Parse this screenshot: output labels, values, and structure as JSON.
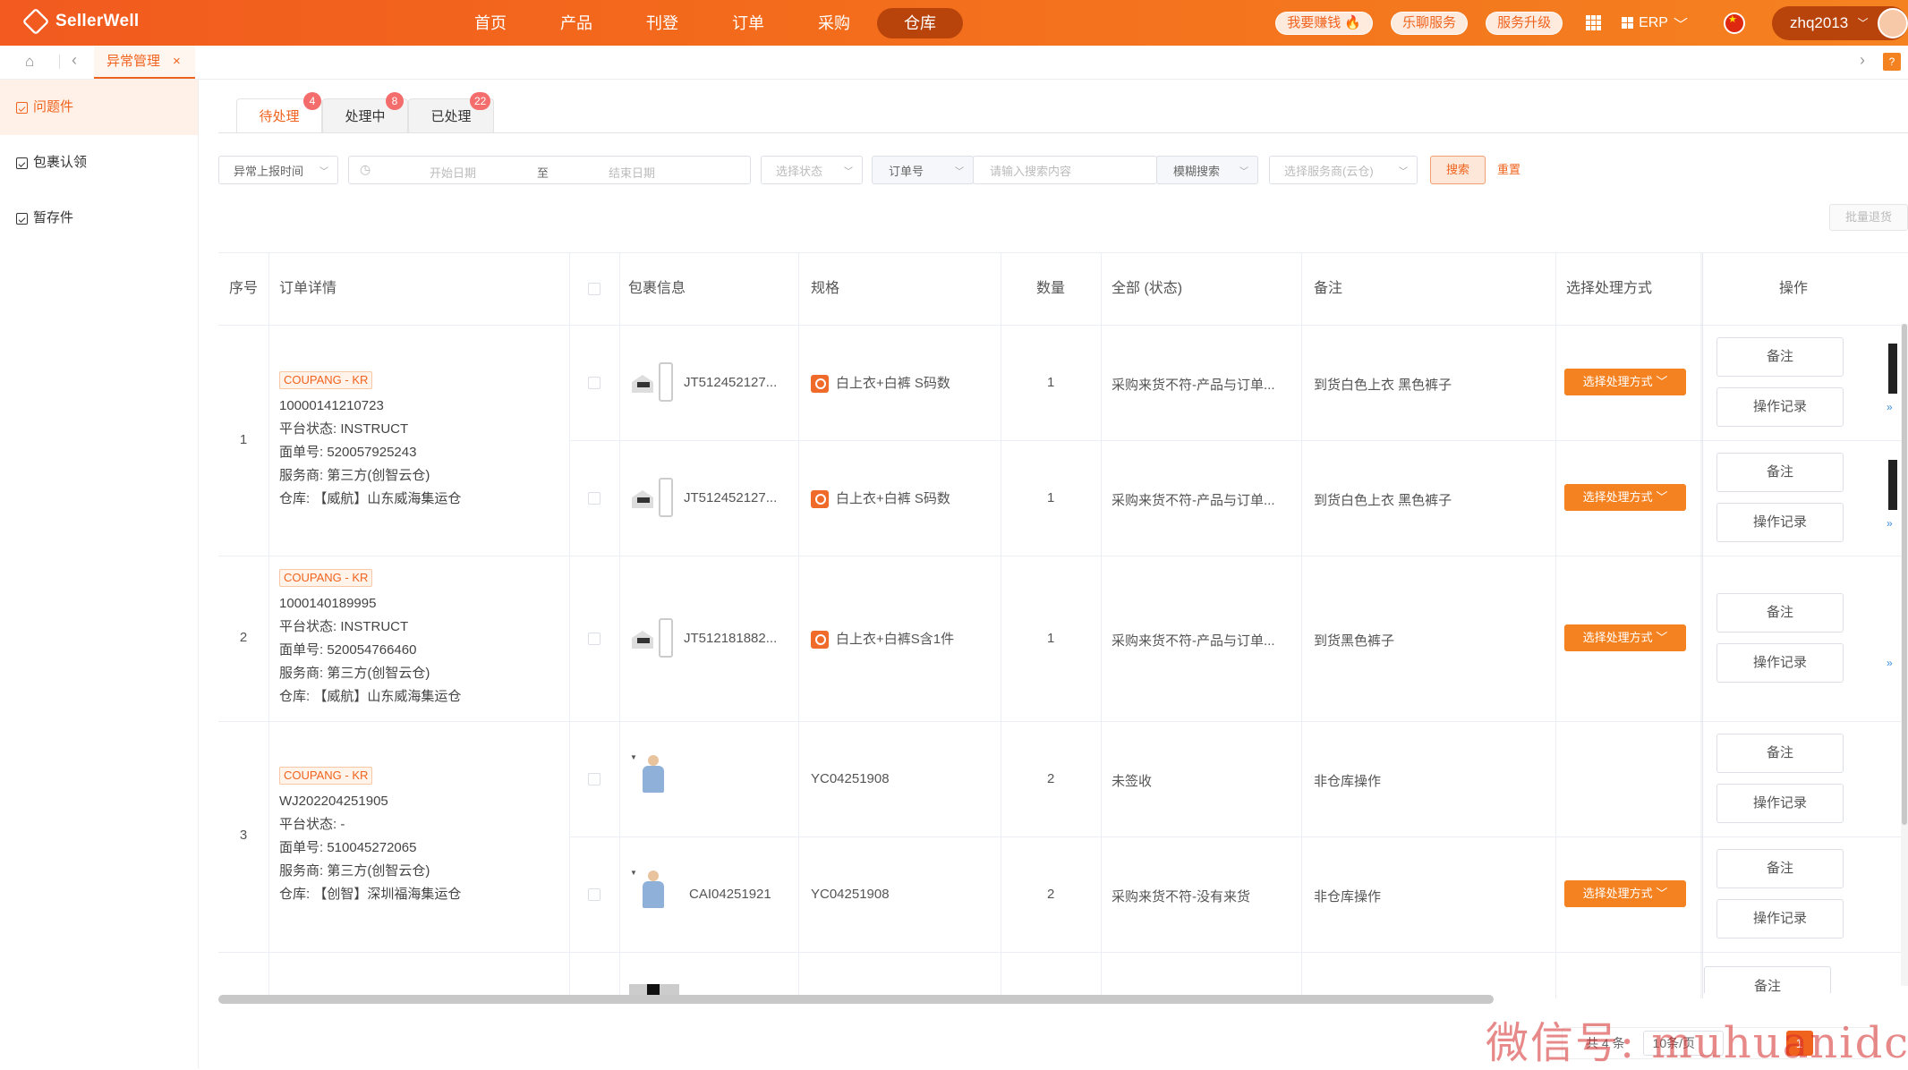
{
  "app": {
    "name": "SellerWell"
  },
  "nav": {
    "items": [
      "首页",
      "产品",
      "刊登",
      "订单",
      "采购",
      "仓库"
    ],
    "active_index": 5
  },
  "header_right": {
    "pills": [
      "我要赚钱 🔥",
      "乐聊服务",
      "服务升级"
    ],
    "erp_label": "ERP",
    "username": "zhq2013"
  },
  "tagbar": {
    "tag_label": "异常管理",
    "close": "×"
  },
  "sidebar": {
    "items": [
      "问题件",
      "包裹认领",
      "暂存件"
    ],
    "active_index": 0
  },
  "tabs": [
    {
      "label": "待处理",
      "badge": "4"
    },
    {
      "label": "处理中",
      "badge": "8"
    },
    {
      "label": "已处理",
      "badge": "22"
    }
  ],
  "filters": {
    "report_time": "异常上报时间",
    "start_date": "开始日期",
    "to": "至",
    "end_date": "结束日期",
    "status": "选择状态",
    "order_field": "订单号",
    "search_placeholder": "请输入搜索内容",
    "fuzzy": "模糊搜索",
    "provider": "选择服务商(云仓)",
    "search_btn": "搜索",
    "reset_btn": "重置",
    "batch_btn": "批量退货"
  },
  "table": {
    "headers": [
      "序号",
      "订单详情",
      "包裹信息",
      "规格",
      "数量",
      "全部 (状态)",
      "备注",
      "选择处理方式",
      "操作"
    ],
    "method_label": "选择处理方式",
    "op_note": "备注",
    "op_log": "操作记录",
    "orders": [
      {
        "seq": "1",
        "platform": "COUPANG - KR",
        "order_no": "10000141210723",
        "platform_status": "平台状态: INSTRUCT",
        "waybill": "面单号: 520057925243",
        "provider": "服务商: 第三方(创智云仓)",
        "warehouse": "仓库: 【威航】山东威海集运仓",
        "items": [
          {
            "package": "JT512452127...",
            "spec": "白上衣+白裤 S码数",
            "qty": "1",
            "status": "采购来货不符-产品与订单...",
            "remark": "到货白色上衣 黑色裤子"
          },
          {
            "package": "JT512452127...",
            "spec": "白上衣+白裤 S码数",
            "qty": "1",
            "status": "采购来货不符-产品与订单...",
            "remark": "到货白色上衣 黑色裤子"
          }
        ]
      },
      {
        "seq": "2",
        "platform": "COUPANG - KR",
        "order_no": "1000140189995",
        "platform_status": "平台状态: INSTRUCT",
        "waybill": "面单号: 520054766460",
        "provider": "服务商: 第三方(创智云仓)",
        "warehouse": "仓库: 【威航】山东威海集运仓",
        "items": [
          {
            "package": "JT512181882...",
            "spec": "白上衣+白裤S含1件",
            "qty": "1",
            "status": "采购来货不符-产品与订单...",
            "remark": "到货黑色裤子"
          }
        ]
      },
      {
        "seq": "3",
        "platform": "COUPANG - KR",
        "order_no": "WJ202204251905",
        "platform_status": "平台状态: -",
        "waybill": "面单号: 510045272065",
        "provider": "服务商: 第三方(创智云仓)",
        "warehouse": "仓库: 【创智】深圳福海集运仓",
        "items": [
          {
            "package": "",
            "spec": "YC04251908",
            "qty": "2",
            "status": "未签收",
            "remark": "非仓库操作"
          },
          {
            "package": "CAI04251921",
            "spec": "YC04251908",
            "qty": "2",
            "status": "采购来货不符-没有来货",
            "remark": "非仓库操作"
          }
        ]
      }
    ]
  },
  "pagination": {
    "total": "共 4 条",
    "page_size": "10条/页",
    "current": "1"
  },
  "watermark": "微信号: muhuanidc",
  "colors": {
    "brand": "#f0631e",
    "accent": "#f58220",
    "badge": "#f56c6c"
  }
}
